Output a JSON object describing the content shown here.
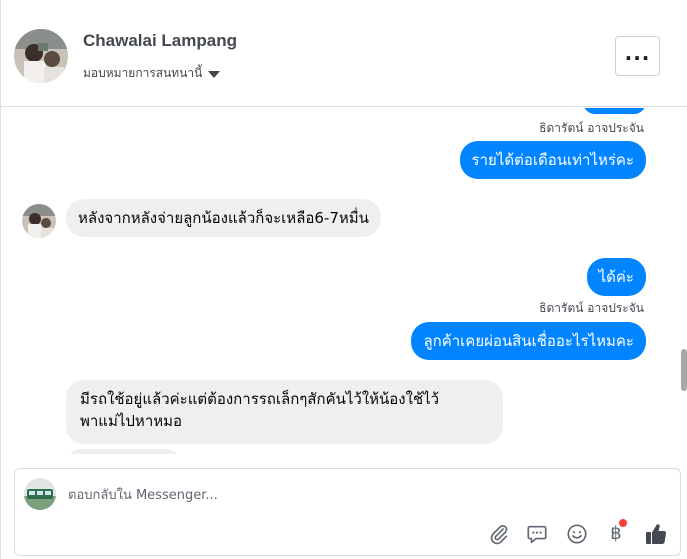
{
  "header": {
    "contact_name": "Chawalai Lampang",
    "assign_label": "มอบหมายการสนทนานี้"
  },
  "messages": [
    {
      "direction": "outgoing",
      "sender": "ธิดารัตน์ อาจประจัน",
      "text": "รายได้ต่อเดือนเท่าไหร่คะ"
    },
    {
      "direction": "incoming",
      "text": "หลังจากหลังจ่ายลูกน้องแล้วก็จะเหลือ6-7หมื่น"
    },
    {
      "direction": "outgoing",
      "sender": "",
      "text": "ได้ค่ะ"
    },
    {
      "direction": "outgoing",
      "sender": "ธิดารัตน์ อาจประจัน",
      "text": "ลูกค้าเคยผ่อนสินเชื่ออะไรไหมคะ"
    },
    {
      "direction": "incoming",
      "text_line1": "มีรถใช้อยู่แล้วค่ะแต่ต้องการรถเล็กๆสักคันไว้ให้น้องใช้ไว้",
      "text_line2": "พาแม่ไปหาหมอ"
    }
  ],
  "composer": {
    "placeholder": "ตอบกลับใน Messenger..."
  },
  "toolbar": {
    "icons": [
      "paperclip-icon",
      "saved-reply-icon",
      "emoji-icon",
      "payment-icon",
      "like-icon"
    ],
    "payment_symbol": "฿",
    "payment_badge_color": "#fa3e3e"
  },
  "colors": {
    "outgoing_bubble": "#0084ff",
    "incoming_bubble": "#efefef"
  }
}
